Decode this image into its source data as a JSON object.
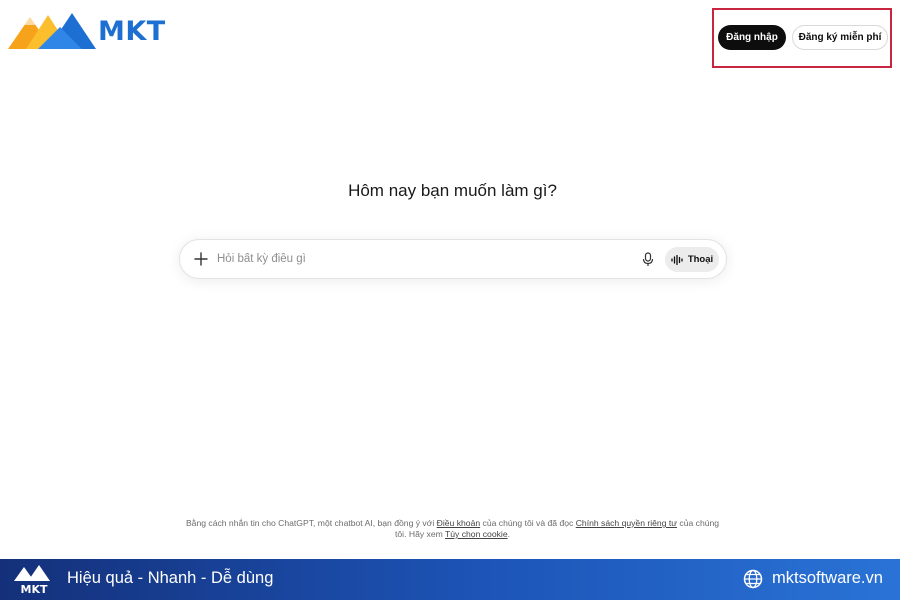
{
  "brand": {
    "logo_text": "MKT"
  },
  "auth": {
    "login_label": "Đăng nhập",
    "signup_label": "Đăng ký miễn phí"
  },
  "main": {
    "heading": "Hôm nay bạn muốn làm gì?"
  },
  "composer": {
    "placeholder": "Hỏi bất kỳ điều gì",
    "value": "",
    "voice_label": "Thoại",
    "icons": [
      "plus-icon",
      "microphone-icon",
      "waveform-icon"
    ]
  },
  "terms": {
    "text_1": "Bằng cách nhắn tin cho ChatGPT, một chatbot AI, bạn đồng ý với ",
    "link_terms": "Điều khoản",
    "text_2": " của chúng tôi và đã đọc ",
    "link_privacy": "Chính sách quyền riêng tư",
    "text_3": " của chúng tôi. Hãy xem ",
    "link_cookie": "Tùy chọn cookie",
    "text_4": "."
  },
  "banner": {
    "logo_text": "MKT",
    "slogan": "Hiệu quả - Nhanh - Dễ dùng",
    "website": "mktsoftware.vn",
    "colors": {
      "start": "#14307a",
      "end": "#2a73d6"
    }
  },
  "colors": {
    "login_bg": "#0d0d0d",
    "highlight_border": "#c8263f",
    "logo_blue": "#1d6fd1",
    "logo_orange": "#f7a21b"
  }
}
